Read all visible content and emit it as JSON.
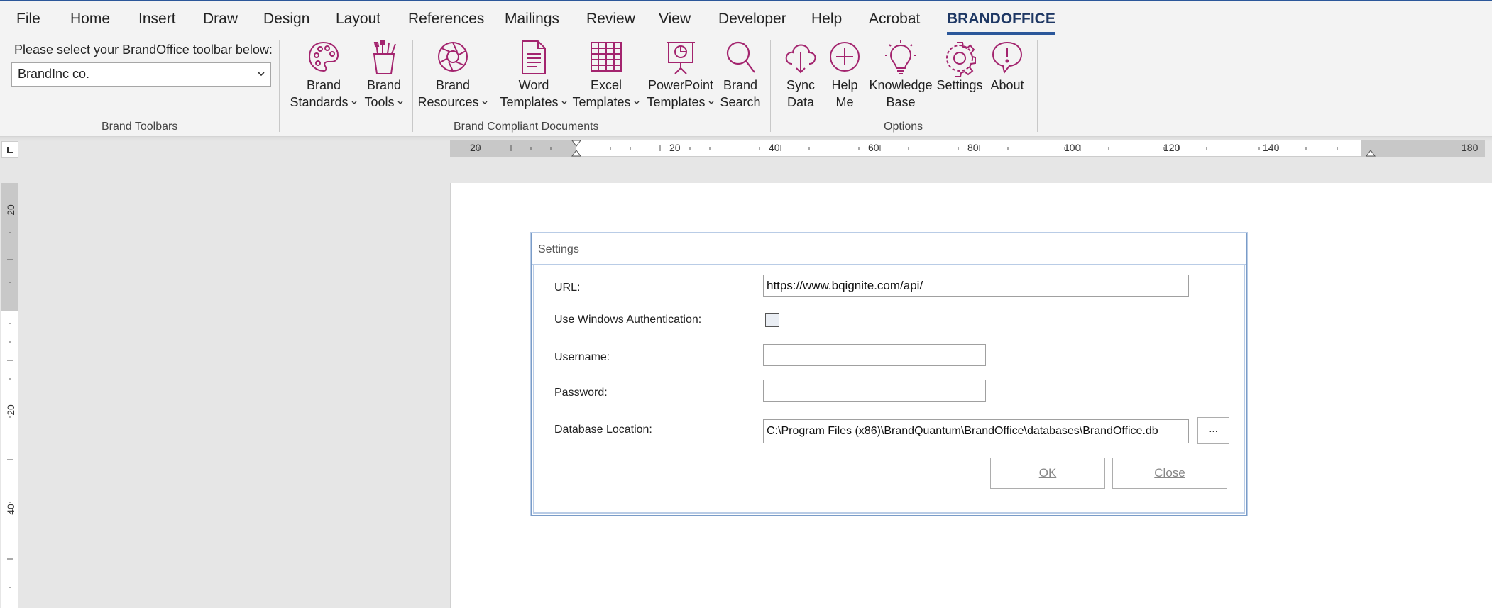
{
  "menu": {
    "tabs": [
      "File",
      "Home",
      "Insert",
      "Draw",
      "Design",
      "Layout",
      "References",
      "Mailings",
      "Review",
      "View",
      "Developer",
      "Help",
      "Acrobat",
      "BRANDOFFICE"
    ]
  },
  "ribbon": {
    "brand_toolbars": {
      "prompt": "Please select your BrandOffice toolbar below:",
      "selected": "BrandInc co.",
      "group_label": "Brand Toolbars"
    },
    "brand_documents": {
      "group_label": "Brand Compliant Documents",
      "buttons": [
        {
          "line1": "Brand",
          "line2": "Standards",
          "icon": "palette-icon"
        },
        {
          "line1": "Brand",
          "line2": "Tools",
          "icon": "brush-cup-icon"
        },
        {
          "line1": "Brand",
          "line2": "Resources",
          "icon": "aperture-icon"
        },
        {
          "line1": "Word",
          "line2": "Templates",
          "icon": "document-icon"
        },
        {
          "line1": "Excel",
          "line2": "Templates",
          "icon": "spreadsheet-icon"
        },
        {
          "line1": "PowerPoint",
          "line2": "Templates",
          "icon": "presentation-icon"
        },
        {
          "line1": "Brand",
          "line2": "Search",
          "icon": "search-icon"
        }
      ]
    },
    "options": {
      "group_label": "Options",
      "buttons": [
        {
          "line1": "Sync",
          "line2": "Data",
          "icon": "cloud-sync-icon"
        },
        {
          "line1": "Help",
          "line2": "Me",
          "icon": "plus-circle-icon"
        },
        {
          "line1": "Knowledge",
          "line2": "Base",
          "icon": "lightbulb-icon"
        },
        {
          "line1": "Settings",
          "line2": "",
          "icon": "gear-icon"
        },
        {
          "line1": "About",
          "line2": "",
          "icon": "exclamation-bubble-icon"
        }
      ]
    },
    "accent_color": "#a3246e"
  },
  "ruler": {
    "h_labels": [
      "20",
      "20",
      "40",
      "60",
      "80",
      "100",
      "120",
      "140",
      "180"
    ],
    "v_labels": [
      "20",
      "20",
      "40"
    ]
  },
  "dialog": {
    "title": "Settings",
    "url_label": "URL:",
    "url_value": "https://www.bqignite.com/api/",
    "winauth_label": "Use Windows Authentication:",
    "winauth_checked": false,
    "username_label": "Username:",
    "username_value": "",
    "password_label": "Password:",
    "password_value": "",
    "dbloc_label": "Database Location:",
    "dbloc_value": "C:\\Program Files (x86)\\BrandQuantum\\BrandOffice\\databases\\BrandOffice.db",
    "browse_label": "...",
    "ok_label": "OK",
    "close_label": "Close"
  }
}
